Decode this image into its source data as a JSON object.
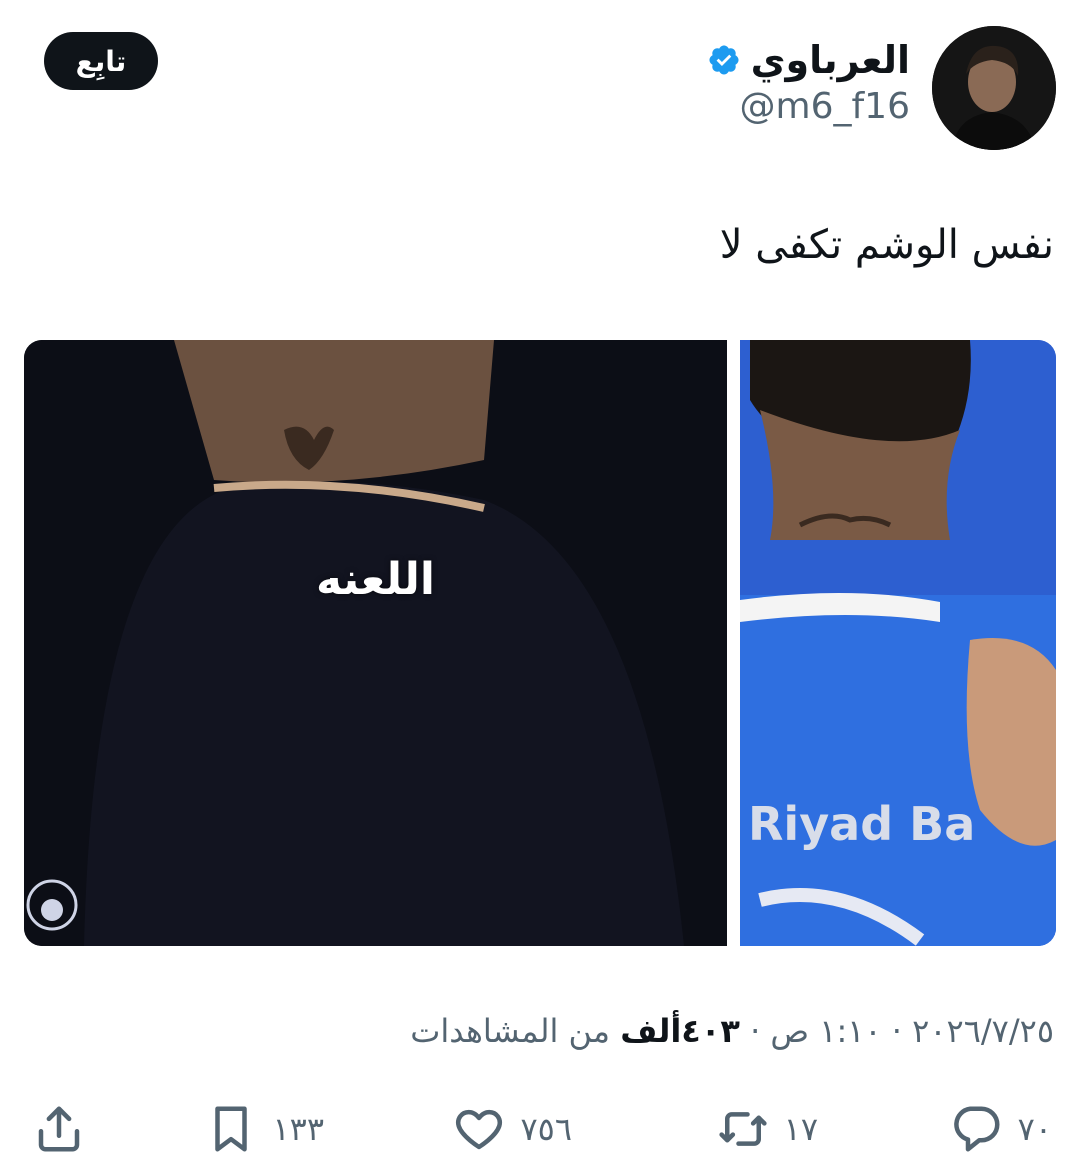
{
  "author": {
    "display_name": "العرباوي",
    "handle": "@m6_f16",
    "verified": true,
    "avatar_icon": "avatar"
  },
  "follow_label": "تابِع",
  "tweet_text": "نفس الوشم تكفى لا",
  "media": {
    "overlay_caption": "اللعنه",
    "right_image_text": "Riyad Ba"
  },
  "meta": {
    "date": "٢٠٢٦/٧/٢٥",
    "time": "١:١٠ ص",
    "separator": "·",
    "views_count": "٤٠٣ألف",
    "views_label": "من المشاهدات"
  },
  "actions": {
    "reply_count": "٧٠",
    "retweet_count": "١٧",
    "like_count": "٧٥٦",
    "bookmark_count": "١٣٣"
  },
  "colors": {
    "text": "#0f1419",
    "secondary": "#536471",
    "verified": "#1d9bf0",
    "follow_bg": "#0f1419",
    "hilal_blue": "#2d5fd0"
  }
}
